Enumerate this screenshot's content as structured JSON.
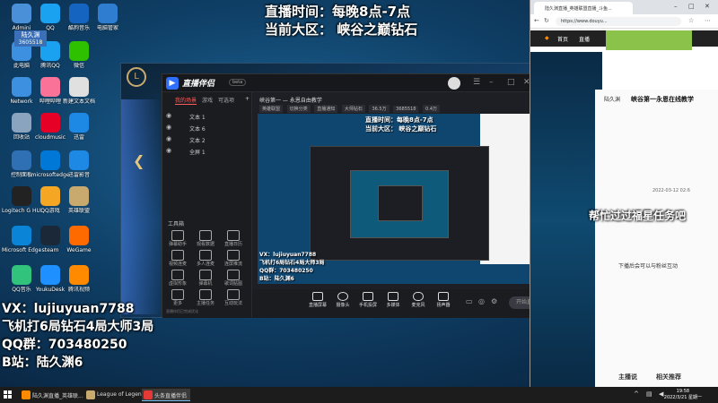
{
  "overlay": {
    "time_line": "直播时间：每晚8点-7点",
    "region_line": "当前大区：  峡谷之巅钻石",
    "vx": "VX：lujiuyuan7788",
    "record": "飞机打6局钻石4局大师3局",
    "qq": "QQ群：703480250",
    "bilibili": "B站：陆久渊6"
  },
  "streamer_tag": {
    "name": "陆久渊",
    "id": "3605518"
  },
  "desktop_icons": [
    {
      "label": "Admini",
      "color": "#4a90d9"
    },
    {
      "label": "QQ",
      "color": "#1aa1f0"
    },
    {
      "label": "酷狗音乐",
      "color": "#1565c0"
    },
    {
      "label": "电脑管家",
      "color": "#2e7dd1"
    },
    {
      "label": "此电脑",
      "color": "#3d8fe0"
    },
    {
      "label": "腾讯QQ",
      "color": "#1aa1f0"
    },
    {
      "label": "微信",
      "color": "#2dc100"
    },
    {
      "label": "Network",
      "color": "#3d8fe0"
    },
    {
      "label": "哔哩哔哩",
      "color": "#fb7299"
    },
    {
      "label": "新建文本文档",
      "color": "#e0e0e0"
    },
    {
      "label": "回收站",
      "color": "#8aa4c0"
    },
    {
      "label": "cloudmusic",
      "color": "#e60026"
    },
    {
      "label": "迅雷",
      "color": "#1e88e5"
    },
    {
      "label": "控制面板",
      "color": "#2f6fb3"
    },
    {
      "label": "microsoftedge",
      "color": "#0078d7"
    },
    {
      "label": "迅雷影音",
      "color": "#1e88e5"
    },
    {
      "label": "Logitech G HUB",
      "color": "#222222"
    },
    {
      "label": "QQ游戏",
      "color": "#f5a623"
    },
    {
      "label": "英雄联盟",
      "color": "#c8aa6e"
    },
    {
      "label": "Microsoft Edge",
      "color": "#0a84d6"
    },
    {
      "label": "steam",
      "color": "#1b2838"
    },
    {
      "label": "WeGame",
      "color": "#ff6a00"
    },
    {
      "label": "QQ音乐",
      "color": "#31c27c"
    },
    {
      "label": "YoukuDesk",
      "color": "#1e90ff"
    },
    {
      "label": "腾讯视频",
      "color": "#ff8a00"
    }
  ],
  "live_app": {
    "name": "直播伴侣",
    "badge": "beta",
    "scene_tabs": [
      "我的场景",
      "游戏",
      "可选项"
    ],
    "scenes": [
      "文本 1",
      "文本 6",
      "文本 2",
      "全屏 1"
    ],
    "tools_label": "工具箱",
    "tools": [
      "弹幕助手",
      "观看数据",
      "直播日历",
      "视频连麦",
      "多人连麦",
      "连屏推流",
      "虚拟形象",
      "弹幕机",
      "歌词贴图",
      "更多",
      "主播任务",
      "互动玩法"
    ],
    "room_title": "峡谷第一 — 永恩自由教学",
    "room_tags": [
      "英雄联盟",
      "切换分类"
    ],
    "room_meta": [
      "直播通知",
      "大师钻石",
      "36.5万",
      "3685518",
      "0.4万"
    ],
    "preview_time": "直播时间：每晚8点-7点",
    "preview_region": "当前大区：  峡谷之巅钻石",
    "preview_vx": "VX：lujiuyuan7788",
    "preview_record": "飞机打6局钻石4局大师3局",
    "preview_qq": "QQ群：703480250",
    "preview_bz": "B站：陆久渊6",
    "controls": [
      "直播屏幕",
      "摄像头",
      "手机投屏",
      "多媒体",
      "麦克风",
      "扬声器"
    ],
    "start_label": "开始直播",
    "bottom_note": "直播伴侣已完成优化"
  },
  "browser": {
    "tab_title": "陆久渊直播_英雄联盟直播_斗鱼...",
    "url": "https://www.douyu...",
    "nav": [
      "首页",
      "直播"
    ],
    "streamer_name": "陆久渊",
    "room_title": "峡谷第一永恩在线教学",
    "date": "2022-03-12 02:6",
    "chat_banner": "帮忙过过福星任务吧",
    "bottom_1": "下播后会可以与粉丝互动",
    "bottom_2": "主播说",
    "bottom_3": "相关推荐"
  },
  "taskbar": {
    "items": [
      "陆久渊直播_英雄联...",
      "League of Legends",
      "头条直播伴侣"
    ],
    "time": "19:58",
    "date": "2022/3/21 星期一"
  }
}
